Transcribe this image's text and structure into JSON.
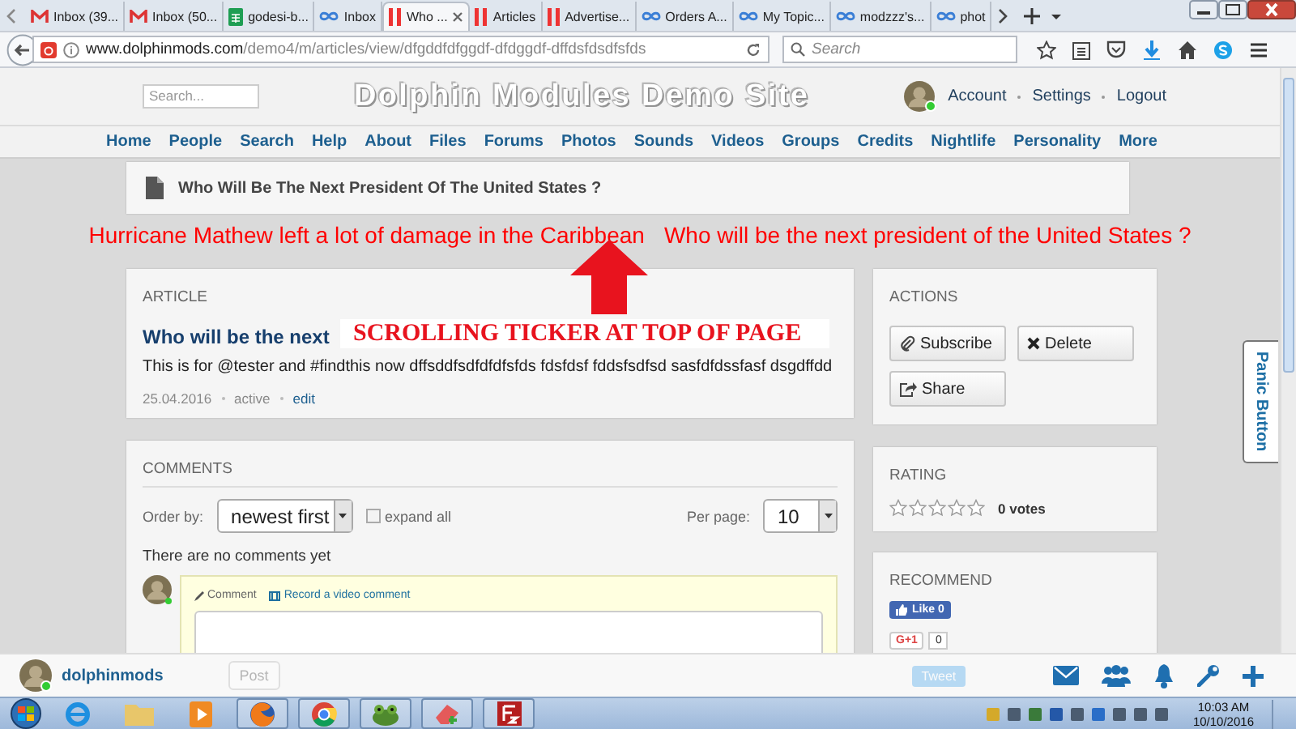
{
  "browser_tabs": [
    {
      "label": "Inbox (39...",
      "kind": "gmail",
      "selected": false
    },
    {
      "label": "Inbox (50...",
      "kind": "gmail",
      "selected": false
    },
    {
      "label": "godesi-b...",
      "kind": "sheets",
      "selected": false
    },
    {
      "label": "Inbox",
      "kind": "loop",
      "selected": false
    },
    {
      "label": "Who ...",
      "kind": "bars",
      "selected": true
    },
    {
      "label": "Articles",
      "kind": "bars",
      "selected": false
    },
    {
      "label": "Advertise...",
      "kind": "bars",
      "selected": false
    },
    {
      "label": "Orders A...",
      "kind": "loop",
      "selected": false
    },
    {
      "label": "My Topic...",
      "kind": "loop",
      "selected": false
    },
    {
      "label": "modzzz's...",
      "kind": "loop",
      "selected": false
    },
    {
      "label": "phot",
      "kind": "loop",
      "selected": false
    }
  ],
  "address_bar": {
    "host": "www.dolphinmods.com",
    "path": "/demo4/m/articles/view/dfgddfdfggdf-dfdggdf-dffdsfdsdfsfds"
  },
  "browser_search": {
    "placeholder": "Search"
  },
  "site_header": {
    "search": {
      "placeholder": "Search..."
    },
    "title": "Dolphin Modules Demo Site",
    "account_links": [
      "Account",
      "Settings",
      "Logout"
    ]
  },
  "nav": [
    "Home",
    "People",
    "Search",
    "Help",
    "About",
    "Files",
    "Forums",
    "Photos",
    "Sounds",
    "Videos",
    "Groups",
    "Credits",
    "Nightlife",
    "Personality",
    "More"
  ],
  "breadcrumb": "Who Will Be The Next President Of The United States ?",
  "ticker": [
    "Hurricane Mathew left a lot of damage in the Caribbean",
    "Who will be the next president of the United States ?"
  ],
  "annotation": "SCROLLING TICKER AT TOP OF PAGE",
  "article": {
    "heading": "ARTICLE",
    "title": "Who will be the next",
    "body": "This is for @tester and #findthis now dffsddfsdfdfdfsfds fdsfdsf fddsfsdfsd sasfdfdssfasf dsgdffdd",
    "date": "25.04.2016",
    "status": "active",
    "edit_link": "edit"
  },
  "comments": {
    "heading": "COMMENTS",
    "order_label": "Order by:",
    "order_value": "newest first",
    "expand": {
      "label": "expand all",
      "checked": false
    },
    "per_page_label": "Per page:",
    "per_page_value": "10",
    "empty_text": "There are no comments yet",
    "tabs": [
      {
        "label": "Comment",
        "selected": true
      },
      {
        "label": "Record a video comment",
        "selected": false
      }
    ]
  },
  "actions": {
    "heading": "ACTIONS",
    "buttons": [
      {
        "label": "Subscribe",
        "kind": "subscribe"
      },
      {
        "label": "Delete",
        "kind": "delete"
      },
      {
        "label": "Share",
        "kind": "share"
      }
    ]
  },
  "rating": {
    "heading": "RATING",
    "stars": 0,
    "votes": "0 votes"
  },
  "recommend": {
    "heading": "RECOMMEND",
    "like": "Like 0",
    "gplus": {
      "label": "G+1",
      "count": "0"
    }
  },
  "panic_button": "Panic Button",
  "bottom_bar": {
    "username": "dolphinmods",
    "post_button": "Post",
    "tweet_button": "Tweet"
  },
  "taskbar": {
    "time": "10:03 AM",
    "date": "10/10/2016"
  }
}
